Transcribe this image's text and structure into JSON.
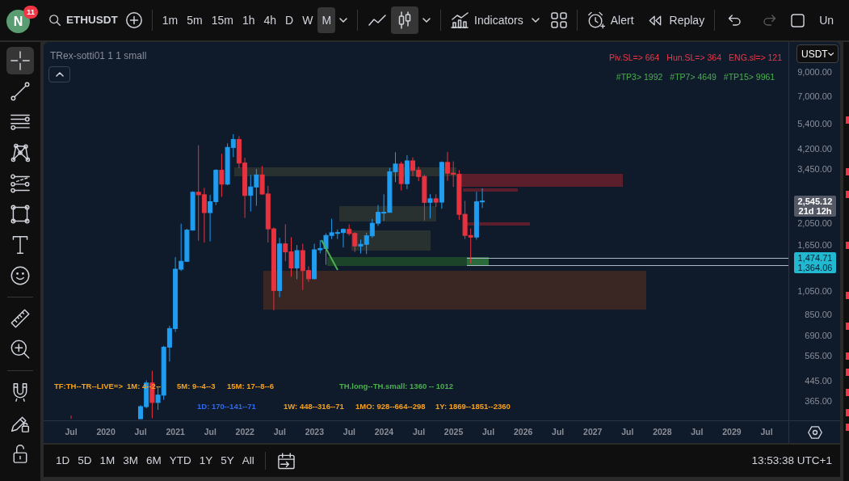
{
  "top_toolbar": {
    "avatar": {
      "letter": "N",
      "badge": "11"
    },
    "symbol": "ETHUSDT",
    "intervals": [
      {
        "label": "1m",
        "selected": false
      },
      {
        "label": "5m",
        "selected": false
      },
      {
        "label": "15m",
        "selected": false
      },
      {
        "label": "1h",
        "selected": false
      },
      {
        "label": "4h",
        "selected": false
      },
      {
        "label": "D",
        "selected": false
      },
      {
        "label": "W",
        "selected": false
      },
      {
        "label": "M",
        "selected": true
      }
    ],
    "chart_types": [
      {
        "kind": "line",
        "selected": false
      },
      {
        "kind": "candles",
        "selected": true
      }
    ],
    "indicators_label": "Indicators",
    "alert_label": "Alert",
    "replay_label": "Replay",
    "undo": {
      "disabled": false
    },
    "redo": {
      "disabled": true
    },
    "cut_label": "Un"
  },
  "drawing_tools": [
    {
      "tools": [
        {
          "kind": "crosshair",
          "selected": true
        },
        {
          "kind": "trend_line",
          "selected": false
        },
        {
          "kind": "fib",
          "selected": false
        },
        {
          "kind": "pattern",
          "selected": false
        },
        {
          "kind": "forecast",
          "selected": false
        },
        {
          "kind": "rectangle",
          "selected": false
        },
        {
          "kind": "text",
          "selected": false
        },
        {
          "kind": "emoji",
          "selected": false
        }
      ]
    },
    {
      "tools": [
        {
          "kind": "ruler",
          "selected": false
        },
        {
          "kind": "zoom",
          "selected": false
        }
      ]
    },
    {
      "tools": [
        {
          "kind": "magnet",
          "selected": false
        },
        {
          "kind": "lock_pencil",
          "selected": false
        },
        {
          "kind": "lock",
          "selected": false
        }
      ]
    }
  ],
  "chart": {
    "legend": "TRex-sotti01 1 1 small",
    "stop_levels": [
      "Piv.SL=> 664",
      "Hun.SL=> 364",
      "ENG.sl=> 121"
    ],
    "targets": [
      "#TP3> 1992",
      "#TP7> 4649",
      "#TP15> 9961"
    ],
    "signal_rows": [
      [
        {
          "text": "TF:TH--TR--LIVE=>",
          "color": "#f7a21b"
        },
        {
          "text": "1M: 4--2--",
          "color": "#f7a21b"
        },
        {
          "text": "5M: 9--4--3",
          "color": "#f7a21b"
        },
        {
          "text": "15M: 17--8--6",
          "color": "#f7a21b"
        },
        {
          "text": "TH.long--TH.small: 1360 -- 1012",
          "color": "#4caf50"
        }
      ],
      [
        {
          "text": "1D: 170--141--71",
          "color": "#2f6bea"
        },
        {
          "text": "1W: 448--316--71",
          "color": "#f7a21b"
        },
        {
          "text": "1MO: 928--664--298",
          "color": "#f7a21b"
        },
        {
          "text": "1Y: 1869--1851--2360",
          "color": "#f7a21b"
        }
      ]
    ]
  },
  "price_axis": {
    "currency": "USDT",
    "labels": [
      "9,000.00",
      "7,000.00",
      "5,400.00",
      "4,200.00",
      "3,450.00",
      "2,050.00",
      "1,650.00",
      "1,050.00",
      "850.00",
      "690.00",
      "565.00",
      "445.00",
      "365.00"
    ],
    "last_price": {
      "price": "2,545.12",
      "countdown": "21d 12h"
    },
    "levels": [
      "1,474.71",
      "1,364.06"
    ]
  },
  "time_axis": {
    "labels": [
      "Jul",
      "2020",
      "Jul",
      "2021",
      "Jul",
      "2022",
      "Jul",
      "2023",
      "Jul",
      "2024",
      "Jul",
      "2025",
      "Jul",
      "2026",
      "Jul",
      "2027",
      "Jul",
      "2028",
      "Jul",
      "2029",
      "Jul"
    ]
  },
  "bottom_toolbar": {
    "ranges": [
      "1D",
      "5D",
      "1M",
      "3M",
      "6M",
      "YTD",
      "1Y",
      "5Y",
      "All"
    ],
    "clock": "13:53:38 UTC+1"
  }
}
